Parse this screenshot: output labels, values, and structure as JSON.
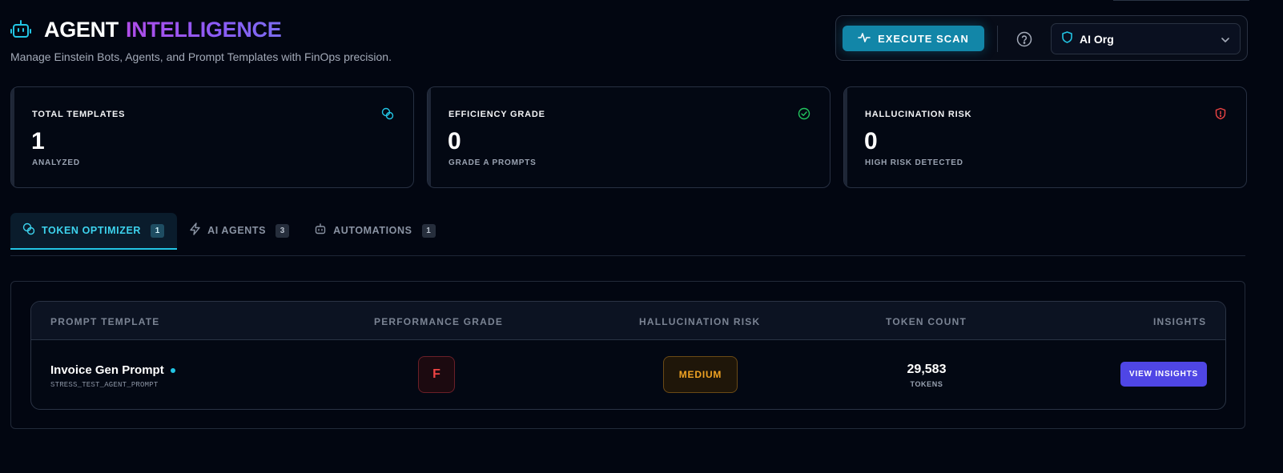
{
  "header": {
    "title_part1": "AGENT",
    "title_part2": "INTELLIGENCE",
    "subtitle": "Manage Einstein Bots, Agents, and Prompt Templates with FinOps precision.",
    "scan_button": "EXECUTE SCAN",
    "org_selector": {
      "value": "AI Org"
    }
  },
  "stats": [
    {
      "label": "TOTAL TEMPLATES",
      "value": "1",
      "sub": "ANALYZED",
      "icon": "coins-icon",
      "color": "#22c5e4"
    },
    {
      "label": "EFFICIENCY GRADE",
      "value": "0",
      "sub": "GRADE A PROMPTS",
      "icon": "check-circle-icon",
      "color": "#22c55e"
    },
    {
      "label": "HALLUCINATION RISK",
      "value": "0",
      "sub": "HIGH RISK DETECTED",
      "icon": "alert-shield-icon",
      "color": "#ef4444"
    }
  ],
  "tabs": [
    {
      "label": "TOKEN OPTIMIZER",
      "count": "1",
      "active": true,
      "icon": "coins-icon"
    },
    {
      "label": "AI AGENTS",
      "count": "3",
      "active": false,
      "icon": "bolt-icon"
    },
    {
      "label": "AUTOMATIONS",
      "count": "1",
      "active": false,
      "icon": "bot-icon"
    }
  ],
  "table": {
    "columns": [
      "PROMPT TEMPLATE",
      "PERFORMANCE GRADE",
      "HALLUCINATION RISK",
      "TOKEN COUNT",
      "INSIGHTS"
    ],
    "rows": [
      {
        "name": "Invoice Gen Prompt",
        "api_name": "STRESS_TEST_AGENT_PROMPT",
        "grade": "F",
        "risk": "MEDIUM",
        "tokens": "29,583",
        "tokens_unit": "TOKENS",
        "action": "VIEW INSIGHTS"
      }
    ]
  },
  "colors": {
    "background": "#020611",
    "accent_cyan": "#22c5e4",
    "accent_purple": "#8b5cf6",
    "button_indigo": "#4f46e5",
    "grade_fail": "#ef4444",
    "risk_medium": "#f0a323"
  }
}
